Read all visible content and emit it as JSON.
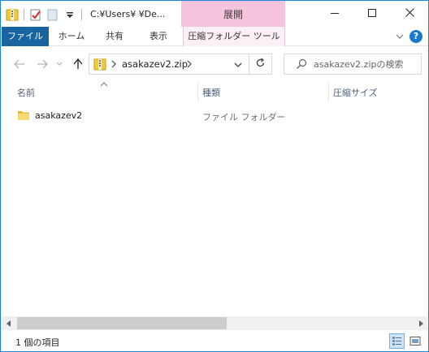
{
  "window": {
    "title_path": "C:¥Users¥ ¥De...",
    "context_tab": "展開",
    "controls": {
      "minimize": "minimize",
      "maximize": "maximize",
      "close": "close"
    }
  },
  "ribbon": {
    "tabs": [
      {
        "label": "ファイル",
        "active": true
      },
      {
        "label": "ホーム"
      },
      {
        "label": "共有"
      },
      {
        "label": "表示"
      },
      {
        "label": "圧縮フォルダー ツール"
      }
    ],
    "help": "?"
  },
  "address": {
    "crumb": "asakazev2.zip"
  },
  "search": {
    "placeholder": "asakazev2.zipの検索",
    "value": ""
  },
  "columns": {
    "name": "名前",
    "type": "種類",
    "size": "圧縮サイズ"
  },
  "files": [
    {
      "name": "asakazev2",
      "type": "ファイル フォルダー",
      "icon": "folder-icon"
    }
  ],
  "status": {
    "item_count": "1 個の項目"
  },
  "colors": {
    "file_tab": "#19639e",
    "context_tab": "#f7c4de",
    "window_border": "#1883d7",
    "column_header": "#4c607a"
  }
}
